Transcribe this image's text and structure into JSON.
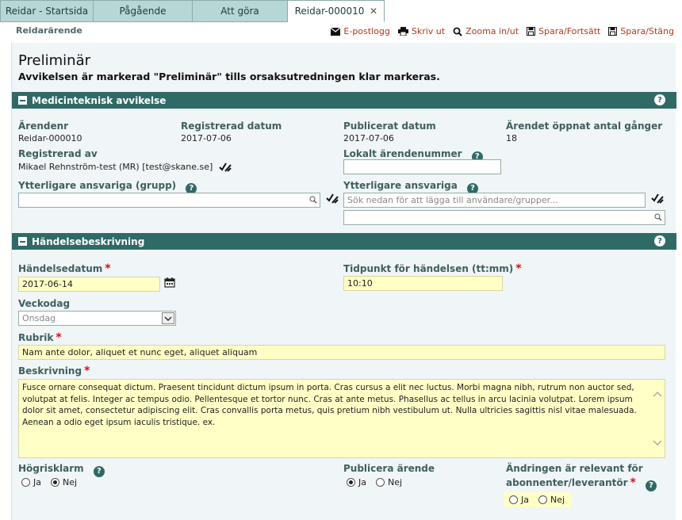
{
  "tabs": [
    {
      "label": "Reidar - Startsida"
    },
    {
      "label": "Pågående"
    },
    {
      "label": "Att göra"
    },
    {
      "label": "Reidar-000010",
      "active": true
    }
  ],
  "header": {
    "crumb": "Reidarärende",
    "toolbar": {
      "email": "E-postlogg",
      "print": "Skriv ut",
      "zoom": "Zooma in/ut",
      "save_continue": "Spara/Fortsätt",
      "save_close": "Spara/Stäng"
    }
  },
  "status": {
    "title": "Preliminär",
    "subtitle": "Avvikelsen är markerad \"Preliminär\" tills orsaksutredningen klar markeras."
  },
  "section1": {
    "title": "Medicinteknisk avvikelse",
    "arendenr_label": "Ärendenr",
    "arendenr_value": "Reidar-000010",
    "registrerad_datum_label": "Registrerad datum",
    "registrerad_datum_value": "2017-07-06",
    "publicerat_datum_label": "Publicerat datum",
    "publicerat_datum_value": "2017-07-06",
    "oppnat_label": "Ärendet öppnat antal gånger",
    "oppnat_value": "18",
    "registrerad_av_label": "Registrerad av",
    "registrerad_av_value": "Mikael Rehnström-test (MR) [test@skane.se]",
    "lokalt_label": "Lokalt ärendenummer",
    "lokalt_value": "",
    "ytterligare_grupp_label": "Ytterligare ansvariga (grupp)",
    "ytterligare_label": "Ytterligare ansvariga",
    "ytterligare_placeholder": "Sök nedan för att lägga till användare/grupper..."
  },
  "section2": {
    "title": "Händelsebeskrivning",
    "handelsedatum_label": "Händelsedatum",
    "handelsedatum_value": "2017-06-14",
    "tidpunkt_label": "Tidpunkt för händelsen (tt:mm)",
    "tidpunkt_value": "10:10",
    "veckodag_label": "Veckodag",
    "veckodag_value": "Onsdag",
    "rubrik_label": "Rubrik",
    "rubrik_value": "Nam ante dolor, aliquet et nunc eget, aliquet aliquam",
    "beskrivning_label": "Beskrivning",
    "beskrivning_value": "Fusce ornare consequat dictum. Praesent tincidunt dictum ipsum in porta. Cras cursus a elit nec luctus. Morbi magna nibh, rutrum non auctor sed, volutpat at felis. Integer ac tempus odio. Pellentesque et tortor nunc. Cras at ante metus. Phasellus ac tellus in arcu lacinia volutpat. Lorem ipsum dolor sit amet, consectetur adipiscing elit. Cras convallis porta metus, quis pretium nibh vestibulum ut. Nulla ultricies sagittis nisl vitae malesuada. Aenean a odio eget ipsum iaculis tristique.  ex.",
    "hogrisklarm_label": "Högrisklarm",
    "publicera_label": "Publicera ärende",
    "andringen_label_1": "Ändringen är relevant för",
    "andringen_label_2": "abonnenter/leverantör",
    "yes": "Ja",
    "no": "Nej"
  }
}
